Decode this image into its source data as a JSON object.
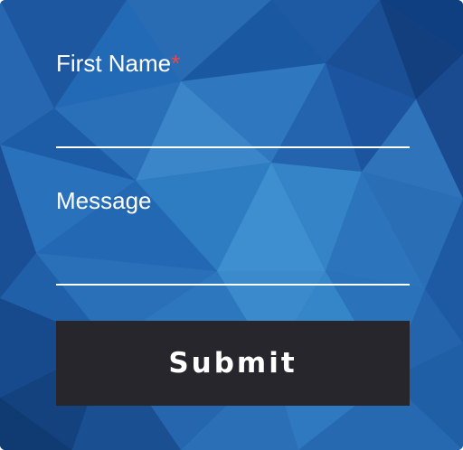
{
  "form": {
    "first_name": {
      "label": "First Name",
      "required_marker": "*",
      "value": ""
    },
    "message": {
      "label": "Message",
      "value": ""
    },
    "submit_label": "Submit"
  },
  "colors": {
    "background_blue": "#1f5fa6",
    "required_marker": "#e5484d",
    "button_background": "#26262c",
    "text": "#ffffff"
  }
}
